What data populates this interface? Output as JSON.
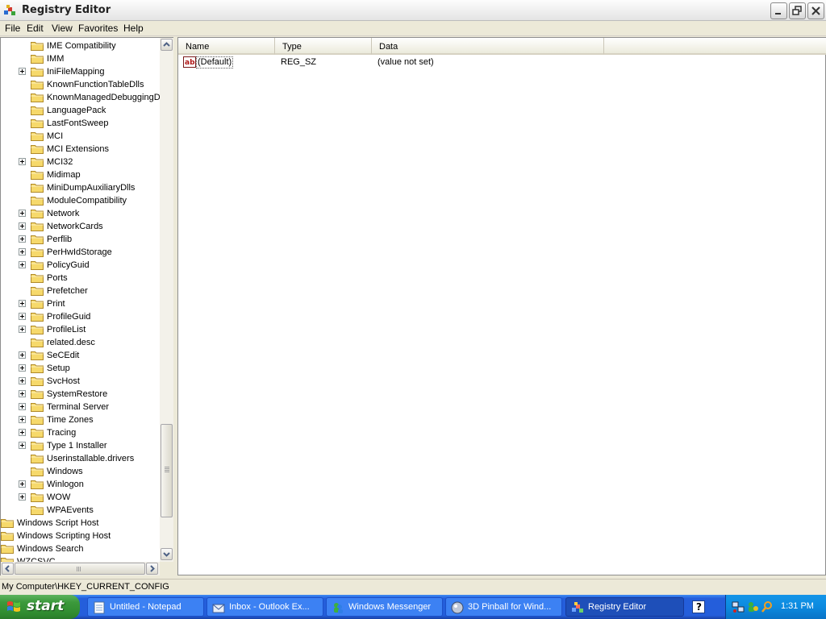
{
  "window": {
    "title": "Registry Editor"
  },
  "menu": [
    "File",
    "Edit",
    "View",
    "Favorites",
    "Help"
  ],
  "tree": {
    "items": [
      {
        "label": "IME Compatibility",
        "level": 2,
        "expandable": false
      },
      {
        "label": "IMM",
        "level": 2,
        "expandable": false
      },
      {
        "label": "IniFileMapping",
        "level": 2,
        "expandable": true
      },
      {
        "label": "KnownFunctionTableDlls",
        "level": 2,
        "expandable": false
      },
      {
        "label": "KnownManagedDebuggingDlls",
        "level": 2,
        "expandable": false
      },
      {
        "label": "LanguagePack",
        "level": 2,
        "expandable": false
      },
      {
        "label": "LastFontSweep",
        "level": 2,
        "expandable": false
      },
      {
        "label": "MCI",
        "level": 2,
        "expandable": false
      },
      {
        "label": "MCI Extensions",
        "level": 2,
        "expandable": false
      },
      {
        "label": "MCI32",
        "level": 2,
        "expandable": true
      },
      {
        "label": "Midimap",
        "level": 2,
        "expandable": false
      },
      {
        "label": "MiniDumpAuxiliaryDlls",
        "level": 2,
        "expandable": false
      },
      {
        "label": "ModuleCompatibility",
        "level": 2,
        "expandable": false
      },
      {
        "label": "Network",
        "level": 2,
        "expandable": true
      },
      {
        "label": "NetworkCards",
        "level": 2,
        "expandable": true
      },
      {
        "label": "Perflib",
        "level": 2,
        "expandable": true
      },
      {
        "label": "PerHwIdStorage",
        "level": 2,
        "expandable": true
      },
      {
        "label": "PolicyGuid",
        "level": 2,
        "expandable": true
      },
      {
        "label": "Ports",
        "level": 2,
        "expandable": false
      },
      {
        "label": "Prefetcher",
        "level": 2,
        "expandable": false
      },
      {
        "label": "Print",
        "level": 2,
        "expandable": true
      },
      {
        "label": "ProfileGuid",
        "level": 2,
        "expandable": true
      },
      {
        "label": "ProfileList",
        "level": 2,
        "expandable": true
      },
      {
        "label": "related.desc",
        "level": 2,
        "expandable": false
      },
      {
        "label": "SeCEdit",
        "level": 2,
        "expandable": true
      },
      {
        "label": "Setup",
        "level": 2,
        "expandable": true
      },
      {
        "label": "SvcHost",
        "level": 2,
        "expandable": true
      },
      {
        "label": "SystemRestore",
        "level": 2,
        "expandable": true
      },
      {
        "label": "Terminal Server",
        "level": 2,
        "expandable": true
      },
      {
        "label": "Time Zones",
        "level": 2,
        "expandable": true
      },
      {
        "label": "Tracing",
        "level": 2,
        "expandable": true
      },
      {
        "label": "Type 1 Installer",
        "level": 2,
        "expandable": true
      },
      {
        "label": "Userinstallable.drivers",
        "level": 2,
        "expandable": false
      },
      {
        "label": "Windows",
        "level": 2,
        "expandable": false
      },
      {
        "label": "Winlogon",
        "level": 2,
        "expandable": true
      },
      {
        "label": "WOW",
        "level": 2,
        "expandable": true
      },
      {
        "label": "WPAEvents",
        "level": 2,
        "expandable": false
      },
      {
        "label": "Windows Script Host",
        "level": 1,
        "expandable": false
      },
      {
        "label": "Windows Scripting Host",
        "level": 1,
        "expandable": false
      },
      {
        "label": "Windows Search",
        "level": 1,
        "expandable": false
      },
      {
        "label": "WZCSVC",
        "level": 1,
        "expandable": false
      }
    ]
  },
  "list": {
    "columns": [
      "Name",
      "Type",
      "Data"
    ],
    "rows": [
      {
        "name": "(Default)",
        "type": "REG_SZ",
        "data": "(value not set)"
      }
    ]
  },
  "status": {
    "path": "My Computer\\HKEY_CURRENT_CONFIG"
  },
  "taskbar": {
    "start_label": "start",
    "tasks": [
      {
        "label": "Untitled - Notepad",
        "icon": "notepad-icon",
        "active": false
      },
      {
        "label": "Inbox - Outlook Ex...",
        "icon": "outlook-express-icon",
        "active": false
      },
      {
        "label": "Windows Messenger",
        "icon": "messenger-icon",
        "active": false
      },
      {
        "label": "3D Pinball for Wind...",
        "icon": "pinball-icon",
        "active": false
      },
      {
        "label": "Registry Editor",
        "icon": "regedit-icon",
        "active": true
      }
    ],
    "clock": "1:31 PM"
  },
  "colors": {
    "taskbar": "#245edb",
    "start": "#3c9a3c",
    "tray": "#0c8adf"
  }
}
